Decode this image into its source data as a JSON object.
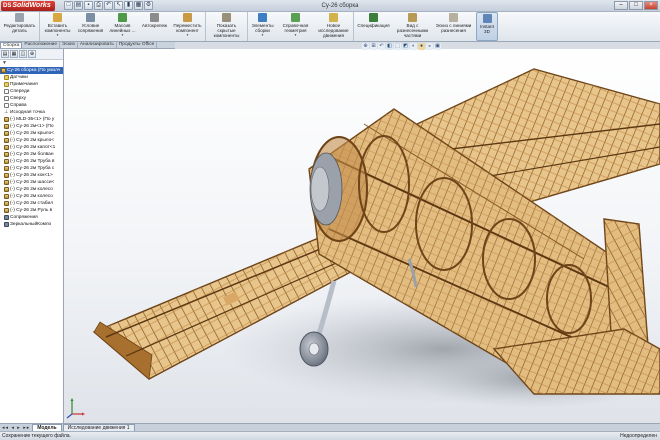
{
  "app": {
    "logo": "SolidWorks",
    "logo_mark": "DS",
    "title": "Су-26 сборка"
  },
  "quick_access": [
    {
      "name": "new-icon",
      "glyph": "□"
    },
    {
      "name": "open-icon",
      "glyph": "▤"
    },
    {
      "name": "save-icon",
      "glyph": "▪"
    },
    {
      "name": "print-icon",
      "glyph": "⎙"
    },
    {
      "name": "undo-icon",
      "glyph": "↶"
    },
    {
      "name": "select-icon",
      "glyph": "↖"
    },
    {
      "name": "rebuild-icon",
      "glyph": "▮"
    },
    {
      "name": "file-properties-icon",
      "glyph": "▦"
    },
    {
      "name": "options-icon",
      "glyph": "⚙"
    }
  ],
  "window_controls": {
    "minimize": "–",
    "maximize": "□",
    "close": "×"
  },
  "ribbon": [
    {
      "id": "edit-component",
      "label": "Редактировать\nдеталь",
      "color": "#9aa3ad",
      "dd": false
    },
    {
      "id": "insert-components",
      "label": "Вставить\nкомпоненты",
      "color": "#d9a740",
      "dd": true
    },
    {
      "id": "mate",
      "label": "Условие\nсопряжения",
      "color": "#7b8ea3",
      "dd": false
    },
    {
      "id": "linear-pattern",
      "label": "Массив\nлинейных ...",
      "color": "#4f9a48",
      "dd": true
    },
    {
      "id": "smartfasteners",
      "label": "Автокрепеж",
      "color": "#8c8c8c",
      "dd": false
    },
    {
      "id": "move-component",
      "label": "Переместить\nкомпонент",
      "color": "#c99a46",
      "dd": true
    },
    {
      "id": "show-hidden",
      "label": "Показать\nскрытые\nкомпоненты",
      "color": "#9a8f7a",
      "dd": false
    },
    {
      "id": "assembly-features",
      "label": "Элементы\nсборки",
      "color": "#3e7fc4",
      "dd": true
    },
    {
      "id": "reference-geometry",
      "label": "Справочная\nгеометрия",
      "color": "#5aa052",
      "dd": true
    },
    {
      "id": "new-motion-study",
      "label": "Новое\nисследование\nдвижения",
      "color": "#d2b24a",
      "dd": false
    },
    {
      "id": "bom",
      "label": "Спецификация",
      "color": "#3b7f3b",
      "dd": false
    },
    {
      "id": "exploded-view",
      "label": "Вид с\nразнесенными\nчастями",
      "color": "#b79b55",
      "dd": false
    },
    {
      "id": "explode-line-sketch",
      "label": "Эскиз с линиями\nразнесения",
      "color": "#b6b0a0",
      "dd": false
    },
    {
      "id": "instant3d",
      "label": "Instant\n3D",
      "color": "#5f86b6",
      "dd": false,
      "active": true
    }
  ],
  "command_tabs": [
    "Сборка",
    "Расположение",
    "Эскиз",
    "Анализировать",
    "Продукты Office"
  ],
  "active_command_tab": 0,
  "headsup_toolbar": [
    "zoom-to-fit-icon",
    "zoom-area-icon",
    "previous-view-icon",
    "section-view-icon",
    "view-orientation-icon",
    "display-style-icon",
    "hide-show-icon",
    "edit-appearance-icon",
    "apply-scene-icon",
    "view-settings-icon"
  ],
  "panel_tools": [
    "feature-manager-icon",
    "property-manager-icon",
    "configuration-manager-icon",
    "dim-xpert-icon"
  ],
  "filter": {
    "glyph": "▼"
  },
  "tree": [
    {
      "label": "Су-26 сборка (По умолч",
      "icon": "part",
      "root": true
    },
    {
      "label": "Датчики",
      "icon": "folder"
    },
    {
      "label": "Примечания",
      "icon": "folder"
    },
    {
      "label": "Спереди",
      "icon": "plane"
    },
    {
      "label": "Сверху",
      "icon": "plane"
    },
    {
      "label": "Справа",
      "icon": "plane"
    },
    {
      "label": "Исходная точка",
      "icon": "origin"
    },
    {
      "label": "(-) MLD-35<1> (По у",
      "icon": "part"
    },
    {
      "label": "(-) Су-26 2м<1> (По",
      "icon": "part"
    },
    {
      "label": "(-) Су-26 2м крыло<",
      "icon": "part"
    },
    {
      "label": "(-) Су-26 2м крыло<",
      "icon": "part"
    },
    {
      "label": "(-) Су-26 2м капот<1",
      "icon": "part"
    },
    {
      "label": "(-) Су-26 2м болван",
      "icon": "part"
    },
    {
      "label": "(-) Су-26 2м Труба в",
      "icon": "part"
    },
    {
      "label": "(-) Су-26 2м Труба с",
      "icon": "part"
    },
    {
      "label": "(-) Су-26 2м кок<1>",
      "icon": "part"
    },
    {
      "label": "(-) Су-26 2м шасси<",
      "icon": "part"
    },
    {
      "label": "(-) Су-26 2м колесо",
      "icon": "part"
    },
    {
      "label": "(-) Су-26 2м колесо",
      "icon": "part"
    },
    {
      "label": "(-) Су-26 2м стабил",
      "icon": "part"
    },
    {
      "label": "(-) Су-26 2м Руль в",
      "icon": "part"
    },
    {
      "label": "Сопряжения",
      "icon": "mate"
    },
    {
      "label": "ЗеркальныйКомпо",
      "icon": "mate"
    }
  ],
  "bottom_tabs": [
    "Модель",
    "Исследование движения 1"
  ],
  "active_bottom_tab": 0,
  "status": {
    "left": "Сохранение текущего файла.",
    "right": "Недоопределен"
  },
  "colors": {
    "wood": "#b07a3a",
    "wood_light": "#d9a866",
    "wood_dark": "#6e4418",
    "accent": "#2f65b8"
  }
}
